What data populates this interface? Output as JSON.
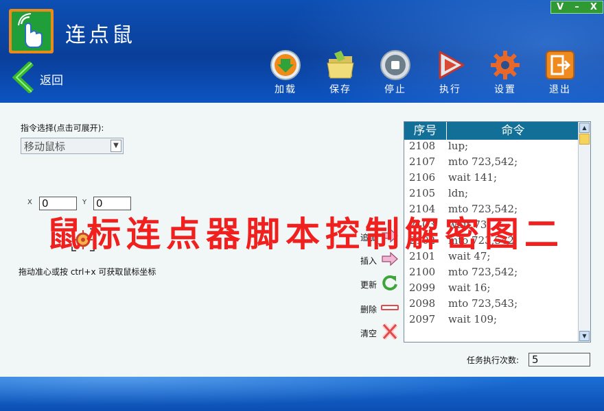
{
  "app": {
    "title": "连点鼠"
  },
  "window_controls": {
    "v": "V",
    "minimize": "–",
    "close": "X"
  },
  "nav": {
    "back_label": "返回"
  },
  "toolbar": [
    {
      "label": "加载",
      "icon": "load-icon"
    },
    {
      "label": "保存",
      "icon": "save-folder-icon"
    },
    {
      "label": "停止",
      "icon": "stop-icon"
    },
    {
      "label": "执行",
      "icon": "play-icon"
    },
    {
      "label": "设置",
      "icon": "gear-icon"
    },
    {
      "label": "退出",
      "icon": "exit-icon"
    }
  ],
  "command_select": {
    "label": "指令选择(点击可展开):",
    "value": "移动鼠标"
  },
  "coords": {
    "x_label": "X",
    "x_value": "0",
    "y_label": "Y",
    "y_value": "0"
  },
  "crosshair_hint": "拖动准心或按 ctrl+x 可获取鼠标坐标",
  "actions": [
    {
      "label": "追加",
      "icon": "append-arrow-icon"
    },
    {
      "label": "插入",
      "icon": "insert-arrow-icon"
    },
    {
      "label": "更新",
      "icon": "refresh-icon"
    },
    {
      "label": "删除",
      "icon": "delete-minus-icon"
    },
    {
      "label": "清空",
      "icon": "clear-x-icon"
    }
  ],
  "command_list": {
    "headers": {
      "seq": "序号",
      "command": "命令"
    },
    "rows": [
      {
        "seq": "2108",
        "cmd": "lup;"
      },
      {
        "seq": "2107",
        "cmd": "mto 723,542;"
      },
      {
        "seq": "2106",
        "cmd": "wait 141;"
      },
      {
        "seq": "2105",
        "cmd": "ldn;"
      },
      {
        "seq": "2104",
        "cmd": "mto 723,542;"
      },
      {
        "seq": "2103",
        "cmd": "wait 73;"
      },
      {
        "seq": "2102",
        "cmd": "mto 723,542;"
      },
      {
        "seq": "2101",
        "cmd": "wait 47;"
      },
      {
        "seq": "2100",
        "cmd": "mto 723,542;"
      },
      {
        "seq": "2099",
        "cmd": "wait 16;"
      },
      {
        "seq": "2098",
        "cmd": "mto 723,543;"
      },
      {
        "seq": "2097",
        "cmd": "wait 109;"
      }
    ]
  },
  "repeat": {
    "label": "任务执行次数:",
    "value": "5"
  },
  "watermark": "鼠标连点器脚本控制解密图二",
  "colors": {
    "header_blue": "#0a3f9a",
    "list_header": "#126f98",
    "watermark_red": "#f0201e",
    "accent_green": "#2f9a33"
  }
}
